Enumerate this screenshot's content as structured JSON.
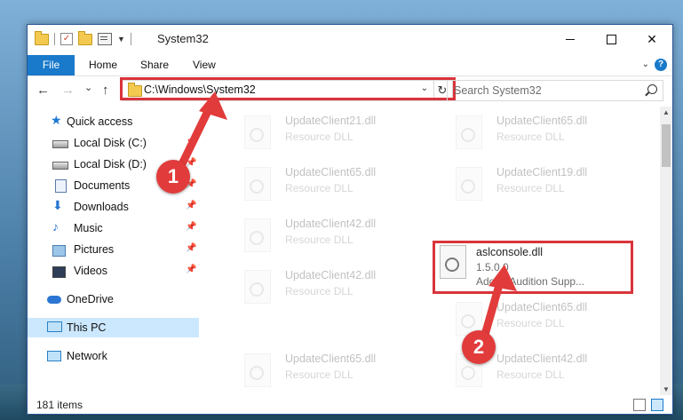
{
  "window": {
    "title": "System32",
    "controls": {
      "minimize": "",
      "maximize": "",
      "close": "✕"
    }
  },
  "ribbon": {
    "tabs": [
      "File",
      "Home",
      "Share",
      "View"
    ],
    "help": "?"
  },
  "navigation": {
    "back": "←",
    "forward": "→",
    "recent": "⌄",
    "up": "↑",
    "address": "C:\\Windows\\System32",
    "refresh": "↻",
    "search_placeholder": "Search System32"
  },
  "sidebar": {
    "items": [
      {
        "label": "Quick access",
        "icon": "star-icon"
      },
      {
        "label": "Local Disk (C:)",
        "icon": "disk-icon",
        "pinned": true
      },
      {
        "label": "Local Disk (D:)",
        "icon": "disk-icon",
        "pinned": true
      },
      {
        "label": "Documents",
        "icon": "documents-icon",
        "pinned": true
      },
      {
        "label": "Downloads",
        "icon": "downloads-icon",
        "pinned": true
      },
      {
        "label": "Music",
        "icon": "music-icon",
        "pinned": true
      },
      {
        "label": "Pictures",
        "icon": "pictures-icon",
        "pinned": true
      },
      {
        "label": "Videos",
        "icon": "videos-icon",
        "pinned": true
      },
      {
        "label": "OneDrive",
        "icon": "cloud-icon"
      },
      {
        "label": "This PC",
        "icon": "computer-icon",
        "selected": true
      },
      {
        "label": "Network",
        "icon": "network-icon"
      }
    ]
  },
  "files": [
    {
      "name": "UpdateClient21.dll",
      "desc": "Resource DLL"
    },
    {
      "name": "UpdateClient65.dll",
      "desc": "Resource DLL"
    },
    {
      "name": "UpdateClient65.dll",
      "desc": "Resource DLL"
    },
    {
      "name": "UpdateClient19.dll",
      "desc": "Resource DLL"
    },
    {
      "name": "UpdateClient42.dll",
      "desc": "Resource DLL"
    },
    {
      "name": "aslconsole.dll",
      "desc": "1.5.0.0",
      "desc2": "Adobe Audition Supp...",
      "highlighted": true
    },
    {
      "name": "UpdateClient42.dll",
      "desc": "Resource DLL"
    },
    {
      "name": "UpdateClient65.dll",
      "desc": "Resource DLL"
    },
    {
      "name": "UpdateClient65.dll",
      "desc": "Resource DLL"
    },
    {
      "name": "UpdateClient42.dll",
      "desc": "Resource DLL"
    }
  ],
  "status": {
    "items_count": "181 items"
  },
  "annotations": {
    "step1": "1",
    "step2": "2"
  },
  "colors": {
    "accent": "#1979ca",
    "highlight_red": "#d9343a",
    "selection": "#cce8ff"
  }
}
